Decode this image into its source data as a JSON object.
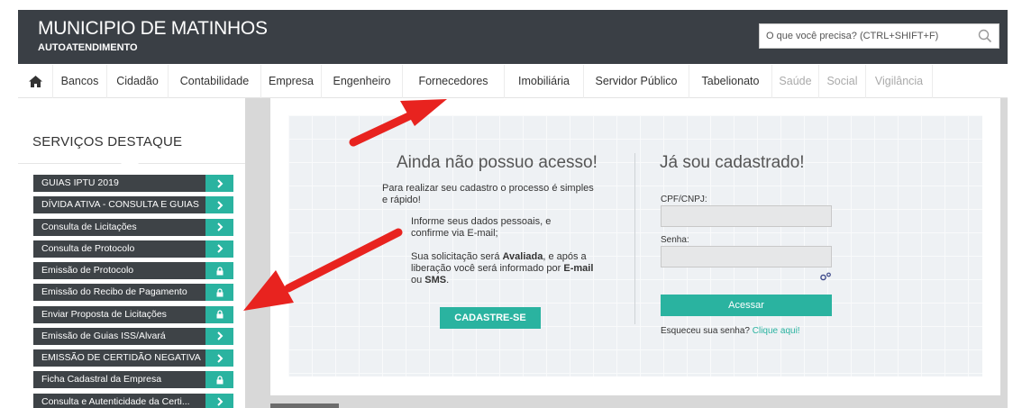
{
  "header": {
    "title": "MUNICIPIO DE MATINHOS",
    "subtitle": "AUTOATENDIMENTO",
    "search_placeholder": "O que você precisa? (CTRL+SHIFT+F)"
  },
  "nav": {
    "home_icon": "home-icon",
    "items": [
      {
        "label": "Bancos"
      },
      {
        "label": "Cidadão"
      },
      {
        "label": "Contabilidade"
      },
      {
        "label": "Empresa"
      },
      {
        "label": "Engenheiro"
      },
      {
        "label": "Fornecedores"
      },
      {
        "label": "Imobiliária"
      },
      {
        "label": "Servidor Público"
      },
      {
        "label": "Tabelionato"
      },
      {
        "label": "Saúde"
      },
      {
        "label": "Social"
      },
      {
        "label": "Vigilância"
      }
    ]
  },
  "sidebar": {
    "title": "SERVIÇOS DESTAQUE",
    "items": [
      {
        "label": "GUIAS IPTU 2019",
        "icon": "chevron-right-icon"
      },
      {
        "label": "DÍVIDA ATIVA - CONSULTA E GUIAS",
        "icon": "chevron-right-icon"
      },
      {
        "label": "Consulta de Licitações",
        "icon": "chevron-right-icon"
      },
      {
        "label": "Consulta de Protocolo",
        "icon": "chevron-right-icon"
      },
      {
        "label": "Emissão de Protocolo",
        "icon": "lock-icon"
      },
      {
        "label": "Emissão do Recibo de Pagamento",
        "icon": "lock-icon"
      },
      {
        "label": "Enviar Proposta de Licitações",
        "icon": "lock-icon"
      },
      {
        "label": "Emissão de Guias ISS/Alvará",
        "icon": "chevron-right-icon"
      },
      {
        "label": "EMISSÃO DE CERTIDÃO NEGATIVA",
        "icon": "chevron-right-icon"
      },
      {
        "label": "Ficha Cadastral da Empresa",
        "icon": "lock-icon"
      },
      {
        "label": "Consulta e Autenticidade da Certi...",
        "icon": "chevron-right-icon"
      }
    ]
  },
  "signup": {
    "title": "Ainda não possuo acesso!",
    "para1": "Para realizar seu cadastro o processo é simples e rápido!",
    "para2": "Informe seus dados pessoais, e confirme via E-mail;",
    "para3_a": "Sua solicitação será ",
    "para3_b": "Avaliada",
    "para3_c": ", e após a liberação você será informado por ",
    "para3_d": "E-mail",
    "para3_e": " ou ",
    "para3_f": "SMS",
    "para3_g": ".",
    "button": "CADASTRE-SE"
  },
  "login": {
    "title": "Já sou cadastrado!",
    "cpf_label": "CPF/CNPJ:",
    "cpf_value": "",
    "password_label": "Senha:",
    "password_value": "",
    "button": "Acessar",
    "forgot_text": "Esqueceu sua senha? ",
    "forgot_link": "Clique aqui!"
  },
  "colors": {
    "header_bg": "#3a3f45",
    "accent": "#2ab3a0",
    "arrow": "#e8231f"
  }
}
